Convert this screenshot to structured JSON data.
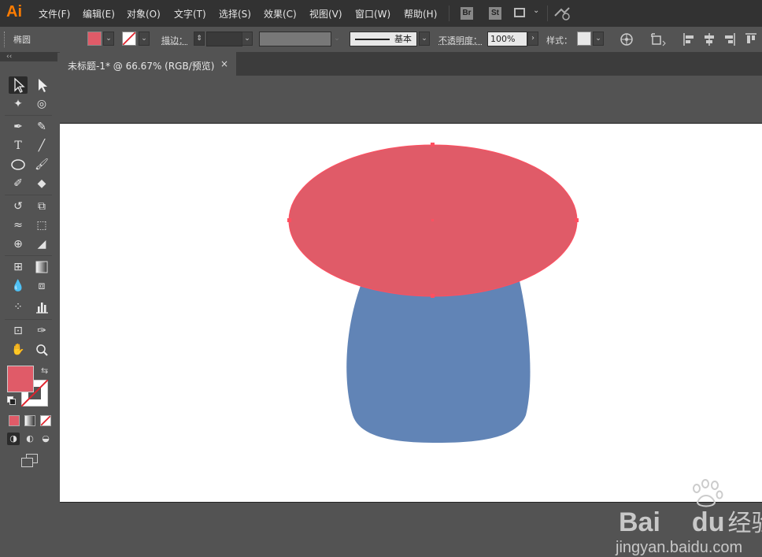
{
  "app": {
    "logo": "Ai"
  },
  "menu": [
    "文件(F)",
    "编辑(E)",
    "对象(O)",
    "文字(T)",
    "选择(S)",
    "效果(C)",
    "视图(V)",
    "窗口(W)",
    "帮助(H)"
  ],
  "menubar_icons": {
    "bridge": "Br",
    "stock": "St"
  },
  "control_bar": {
    "shape_name": "椭圆",
    "stroke_label": "描边：",
    "stroke_style": "基本",
    "opacity_label": "不透明度：",
    "opacity_value": "100%",
    "style_label": "样式："
  },
  "document_tab": {
    "title": "未标题-1* @ 66.67% (RGB/预览)",
    "close": "×"
  },
  "colors": {
    "fill": "#e05b68",
    "stem": "#6184b6",
    "canvas": "#ffffff",
    "ui_dark": "#323232",
    "ui_mid": "#535353"
  },
  "watermark": {
    "brand_left": "Bai",
    "brand_right": "du",
    "brand_cn": "经验",
    "url": "jingyan.baidu.com"
  }
}
